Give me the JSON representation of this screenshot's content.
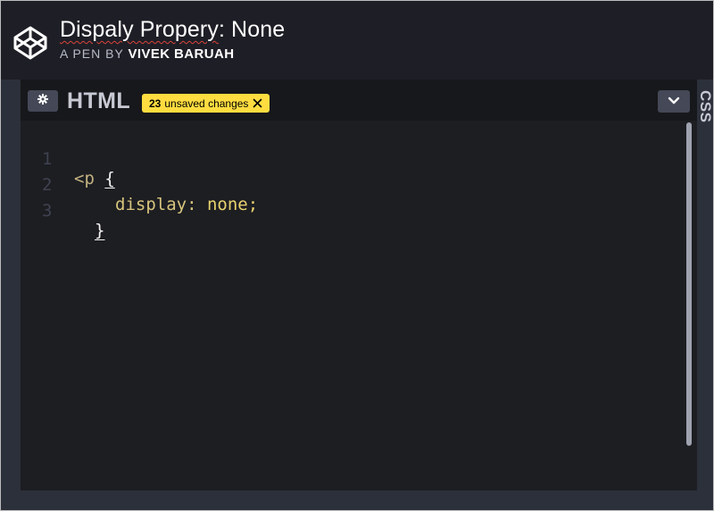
{
  "header": {
    "title_typo": "Dispaly Propery",
    "title_rest": ": None",
    "byline_prefix": "A PEN BY",
    "author": "VIVEK BARUAH",
    "logo_icon": "codepen-logo-icon"
  },
  "editor": {
    "label": "HTML",
    "settings_icon": "gear-icon",
    "unsaved": {
      "count": "23",
      "text": "unsaved changes",
      "close_icon": "close-icon"
    },
    "dropdown_icon": "chevron-down-icon",
    "lines": [
      {
        "number": "1",
        "tag": "<p",
        "brace": "{"
      },
      {
        "number": "2",
        "prop": "display:",
        "value": "none;"
      },
      {
        "number": "3",
        "brace": "}"
      }
    ]
  },
  "side_tab": {
    "label": "CSS"
  },
  "colors": {
    "badge": "#ffdd40",
    "background": "#1d1e22",
    "header": "#1e1f26"
  }
}
